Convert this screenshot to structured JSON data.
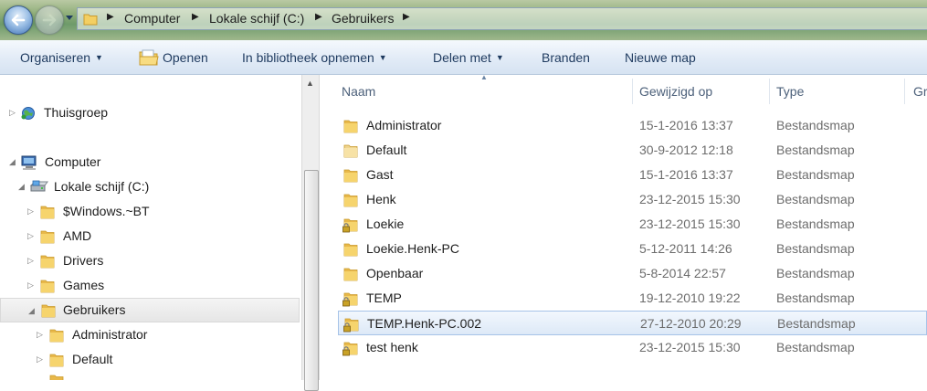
{
  "address_bar": {
    "breadcrumbs": [
      "Computer",
      "Lokale schijf (C:)",
      "Gebruikers"
    ]
  },
  "toolbar": {
    "organize": "Organiseren",
    "open": "Openen",
    "include_library": "In bibliotheek opnemen",
    "share": "Delen met",
    "burn": "Branden",
    "new_folder": "Nieuwe map"
  },
  "nav": {
    "homegroup": "Thuisgroep",
    "computer": "Computer",
    "drive": "Lokale schijf (C:)",
    "folders": [
      "$Windows.~BT",
      "AMD",
      "Drivers",
      "Games",
      "Gebruikers"
    ],
    "users": [
      "Administrator",
      "Default"
    ]
  },
  "columns": {
    "name": "Naam",
    "modified": "Gewijzigd op",
    "type": "Type",
    "size": "Gr"
  },
  "files": [
    {
      "name": "Administrator",
      "date": "15-1-2016 13:37",
      "type": "Bestandsmap",
      "locked": false,
      "faded": false
    },
    {
      "name": "Default",
      "date": "30-9-2012 12:18",
      "type": "Bestandsmap",
      "locked": false,
      "faded": true
    },
    {
      "name": "Gast",
      "date": "15-1-2016 13:37",
      "type": "Bestandsmap",
      "locked": false,
      "faded": false
    },
    {
      "name": "Henk",
      "date": "23-12-2015 15:30",
      "type": "Bestandsmap",
      "locked": false,
      "faded": false
    },
    {
      "name": "Loekie",
      "date": "23-12-2015 15:30",
      "type": "Bestandsmap",
      "locked": true,
      "faded": false
    },
    {
      "name": "Loekie.Henk-PC",
      "date": "5-12-2011 14:26",
      "type": "Bestandsmap",
      "locked": false,
      "faded": false
    },
    {
      "name": "Openbaar",
      "date": "5-8-2014 22:57",
      "type": "Bestandsmap",
      "locked": false,
      "faded": false
    },
    {
      "name": "TEMP",
      "date": "19-12-2010 19:22",
      "type": "Bestandsmap",
      "locked": true,
      "faded": false
    },
    {
      "name": "TEMP.Henk-PC.002",
      "date": "27-12-2010 20:29",
      "type": "Bestandsmap",
      "locked": true,
      "faded": false,
      "selected": true
    },
    {
      "name": "test henk",
      "date": "23-12-2015 15:30",
      "type": "Bestandsmap",
      "locked": true,
      "faded": false
    }
  ],
  "icons": {
    "folder": "folder-icon",
    "locked_folder": "locked-folder-icon",
    "homegroup": "homegroup-icon",
    "computer": "computer-icon",
    "drive": "drive-icon"
  },
  "colors": {
    "folder": "#f3cf62",
    "selection_border": "#a6c3e8",
    "command_text": "#1e3a5f"
  }
}
